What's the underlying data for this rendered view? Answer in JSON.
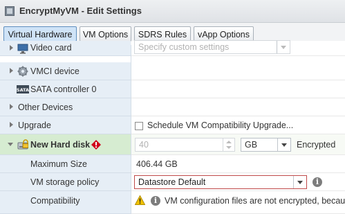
{
  "window": {
    "title": "EncryptMyVM - Edit Settings"
  },
  "tabs": [
    {
      "label": "Virtual Hardware",
      "active": true
    },
    {
      "label": "VM Options",
      "active": false
    },
    {
      "label": "SDRS Rules",
      "active": false
    },
    {
      "label": "vApp Options",
      "active": false
    }
  ],
  "rows": {
    "video_card": {
      "label": "Video card",
      "value_placeholder": "Specify custom settings"
    },
    "vmci": {
      "label": "VMCI device"
    },
    "sata": {
      "label": "SATA controller 0"
    },
    "other": {
      "label": "Other Devices"
    },
    "upgrade": {
      "label": "Upgrade",
      "checkbox_label": "Schedule VM Compatibility Upgrade..."
    },
    "new_disk": {
      "label": "New Hard disk",
      "size_value": "40",
      "unit": "GB",
      "status": "Encrypted"
    },
    "max_size": {
      "label": "Maximum Size",
      "value": "406.44 GB"
    },
    "storage_policy": {
      "label": "VM storage policy",
      "value": "Datastore Default"
    },
    "compatibility": {
      "label": "Compatibility",
      "message": "VM configuration files are not encrypted, becaus"
    }
  },
  "colors": {
    "selected_row": "#d6ecd1",
    "label_column": "#e6eef6",
    "policy_border": "#c04a4a",
    "warning_icon": "#f2c200",
    "error_icon": "#d0021b"
  },
  "icons": [
    "vm-icon",
    "monitor-icon",
    "gear-icon",
    "sata-icon",
    "disk-lock-icon",
    "error-icon",
    "info-icon",
    "warning-icon",
    "chevron-down-icon"
  ]
}
